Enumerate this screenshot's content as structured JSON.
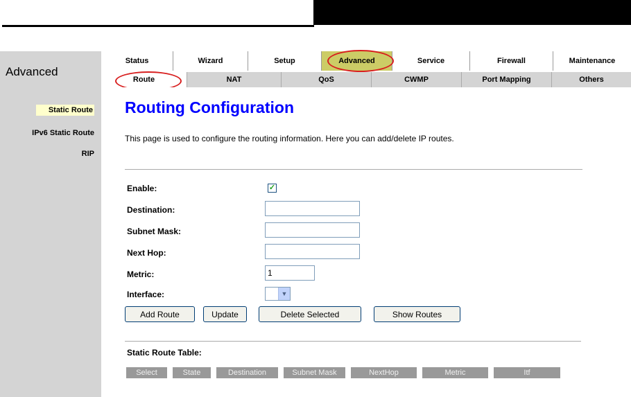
{
  "header": {
    "section_title": "Advanced",
    "primary_tabs": [
      "Status",
      "Wizard",
      "Setup",
      "Advanced",
      "Service",
      "Firewall",
      "Maintenance"
    ],
    "secondary_tabs": [
      "Route",
      "NAT",
      "QoS",
      "CWMP",
      "Port Mapping",
      "Others"
    ]
  },
  "sidebar": {
    "items": [
      "Static Route",
      "IPv6 Static Route",
      "RIP"
    ]
  },
  "main": {
    "title": "Routing Configuration",
    "description": "This page is used to configure the routing information. Here you can add/delete IP routes.",
    "form": {
      "enable_label": "Enable:",
      "enable_checked": true,
      "checkmark": "✓",
      "destination_label": "Destination:",
      "destination_value": "",
      "subnet_mask_label": "Subnet Mask:",
      "subnet_mask_value": "",
      "next_hop_label": "Next Hop:",
      "next_hop_value": "",
      "metric_label": "Metric:",
      "metric_value": "1",
      "interface_label": "Interface:",
      "interface_value": ""
    },
    "buttons": {
      "add_route": "Add Route",
      "update": "Update",
      "delete_selected": "Delete Selected",
      "show_routes": "Show Routes"
    },
    "table": {
      "title": "Static Route Table:",
      "columns": [
        "Select",
        "State",
        "Destination",
        "Subnet Mask",
        "NextHop",
        "Metric",
        "Itf"
      ]
    }
  },
  "colors": {
    "title_blue": "#0000ff",
    "active_tab": "#cccc66",
    "highlight_ring": "#d81f1f",
    "panel_gray": "#d4d4d4",
    "table_header": "#999999"
  }
}
